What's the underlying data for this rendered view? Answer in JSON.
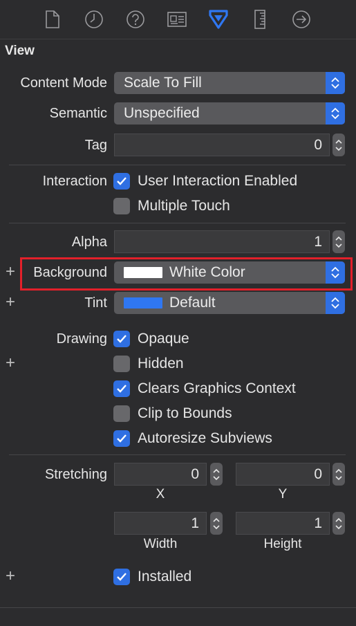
{
  "toolbar": {
    "icons": [
      {
        "name": "file-inspector-icon",
        "selected": false
      },
      {
        "name": "history-inspector-icon",
        "selected": false
      },
      {
        "name": "quick-help-icon",
        "selected": false
      },
      {
        "name": "identity-inspector-icon",
        "selected": false
      },
      {
        "name": "attributes-inspector-icon",
        "selected": true
      },
      {
        "name": "size-inspector-icon",
        "selected": false
      },
      {
        "name": "connections-inspector-icon",
        "selected": false
      }
    ]
  },
  "section": {
    "title": "View"
  },
  "content_mode": {
    "label": "Content Mode",
    "value": "Scale To Fill"
  },
  "semantic": {
    "label": "Semantic",
    "value": "Unspecified"
  },
  "tag": {
    "label": "Tag",
    "value": "0"
  },
  "interaction": {
    "label": "Interaction",
    "options": [
      {
        "label": "User Interaction Enabled",
        "checked": true
      },
      {
        "label": "Multiple Touch",
        "checked": false
      }
    ]
  },
  "alpha": {
    "label": "Alpha",
    "value": "1"
  },
  "background": {
    "label": "Background",
    "value": "White Color",
    "swatch": "#ffffff",
    "plus": "+"
  },
  "tint": {
    "label": "Tint",
    "value": "Default",
    "swatch": "#2f77f2",
    "plus": "+"
  },
  "drawing": {
    "label": "Drawing",
    "plus": "+",
    "options": [
      {
        "label": "Opaque",
        "checked": true
      },
      {
        "label": "Hidden",
        "checked": false
      },
      {
        "label": "Clears Graphics Context",
        "checked": true
      },
      {
        "label": "Clip to Bounds",
        "checked": false
      },
      {
        "label": "Autoresize Subviews",
        "checked": true
      }
    ]
  },
  "stretching": {
    "label": "Stretching",
    "x": {
      "value": "0",
      "label": "X"
    },
    "y": {
      "value": "0",
      "label": "Y"
    },
    "width": {
      "value": "1",
      "label": "Width"
    },
    "height": {
      "value": "1",
      "label": "Height"
    }
  },
  "installed": {
    "label": "Installed",
    "checked": true,
    "plus": "+"
  },
  "colors": {
    "accent": "#2f6fe2",
    "highlight": "#e3202a",
    "background": "#2c2c2e"
  }
}
